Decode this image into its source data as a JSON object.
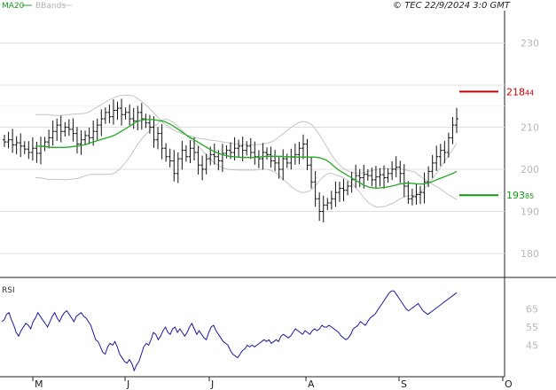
{
  "header": {
    "legend_ma": "MA20",
    "legend_bb": "BBands",
    "timestamp": "© TEC 22/9/2024 3:0 GMT"
  },
  "colors": {
    "price": "#111111",
    "ma": "#22aa22",
    "bands": "#c4c4c4",
    "rsi": "#1a1aa0",
    "resistance": "#cc0000",
    "support": "#119911",
    "grid": "#e0e0e0"
  },
  "chart_data": [
    {
      "type": "ohlc",
      "title": "",
      "legend": [
        "MA20",
        "BBands"
      ],
      "y_ticks": [
        "230",
        "210",
        "200",
        "190",
        "180"
      ],
      "ylim": [
        176,
        236
      ],
      "x_labels": [
        "M",
        "J",
        "J",
        "A",
        "S",
        "O"
      ],
      "levels": [
        {
          "name": "resistance",
          "value": 218.44,
          "label_int": "218",
          "label_dec": "44",
          "color": "#cc0000"
        },
        {
          "name": "support",
          "value": 193.85,
          "label_int": "193",
          "label_dec": "85",
          "color": "#119911"
        }
      ],
      "close": [
        206.5,
        207.0,
        205.8,
        206.3,
        205.5,
        204.8,
        204.0,
        205.0,
        203.8,
        205.5,
        206.5,
        207.5,
        209.0,
        210.5,
        209.0,
        210.0,
        209.5,
        208.5,
        206.0,
        207.0,
        208.0,
        207.5,
        209.0,
        210.5,
        212.0,
        213.5,
        212.5,
        214.0,
        214.5,
        213.0,
        213.5,
        212.0,
        211.5,
        213.5,
        212.0,
        211.0,
        210.0,
        207.0,
        208.5,
        205.0,
        203.0,
        202.0,
        199.0,
        202.5,
        204.5,
        203.0,
        205.0,
        204.0,
        201.0,
        200.0,
        202.5,
        203.5,
        203.0,
        202.0,
        203.8,
        204.5,
        204.0,
        205.0,
        205.5,
        204.5,
        205.5,
        204.0,
        203.0,
        202.5,
        204.0,
        203.5,
        202.0,
        201.5,
        200.0,
        202.5,
        201.5,
        203.0,
        203.5,
        205.0,
        206.0,
        201.0,
        197.0,
        193.0,
        190.0,
        191.5,
        192.0,
        193.0,
        194.5,
        195.5,
        195.0,
        196.0,
        197.5,
        198.5,
        198.0,
        198.8,
        198.5,
        197.5,
        198.2,
        198.7,
        198.0,
        199.0,
        200.0,
        200.5,
        199.0,
        196.0,
        193.0,
        193.5,
        194.0,
        194.5,
        197.0,
        199.5,
        201.5,
        203.0,
        204.5,
        204.0,
        207.5,
        210.5,
        212.0
      ],
      "ma20": [
        205.5,
        205.5,
        205.4,
        205.3,
        205.2,
        205.2,
        205.2,
        205.2,
        205.3,
        205.4,
        205.5,
        205.7,
        205.9,
        206.3,
        206.6,
        206.9,
        207.2,
        207.5,
        207.8,
        208.2,
        208.8,
        209.4,
        210.0,
        210.7,
        211.3,
        211.6,
        211.8,
        211.8,
        211.8,
        211.6,
        211.5,
        211.2,
        210.7,
        210.1,
        209.4,
        208.7,
        208.0,
        207.4,
        206.8,
        206.2,
        205.6,
        205.0,
        204.4,
        204.0,
        203.6,
        203.3,
        203.1,
        203.0,
        202.9,
        202.8,
        202.8,
        202.8,
        202.8,
        202.9,
        203.0,
        203.1,
        203.1,
        203.1,
        203.1,
        203.0,
        203.0,
        202.9,
        202.9,
        202.9,
        202.9,
        202.9,
        202.9,
        202.8,
        202.6,
        202.2,
        201.5,
        200.6,
        199.8,
        199.2,
        198.6,
        198.0,
        197.4,
        196.8,
        196.2,
        195.8,
        195.6,
        195.5,
        195.6,
        195.7,
        195.9,
        196.1,
        196.4,
        196.6,
        196.7,
        196.7,
        196.6,
        196.5,
        196.5,
        196.7,
        197.0,
        197.4,
        197.8,
        198.2,
        198.6,
        199.0,
        199.5
      ],
      "upper_band": [
        213.0,
        213.0,
        213.0,
        213.0,
        212.8,
        212.8,
        212.8,
        212.9,
        213.0,
        213.1,
        213.2,
        213.2,
        213.3,
        213.8,
        214.4,
        215.0,
        215.6,
        216.2,
        216.7,
        217.2,
        217.5,
        217.6,
        217.6,
        217.5,
        217.0,
        216.3,
        215.5,
        214.5,
        213.5,
        212.4,
        211.3,
        210.5,
        209.8,
        209.2,
        208.8,
        208.4,
        208.1,
        207.8,
        207.5,
        207.3,
        207.2,
        207.0,
        206.9,
        206.8,
        206.6,
        206.4,
        206.3,
        206.1,
        206.0,
        205.8,
        205.8,
        205.8,
        205.8,
        205.9,
        206.0,
        206.2,
        206.5,
        207.0,
        207.8,
        208.6,
        209.4,
        210.2,
        210.8,
        211.3,
        211.3,
        211.0,
        210.2,
        208.8,
        207.3,
        205.6,
        203.9,
        202.4,
        201.2,
        200.3,
        199.7,
        199.3,
        199.1,
        199.1,
        199.2,
        199.5,
        199.7,
        200.0,
        200.1,
        200.2,
        200.2,
        200.2,
        200.1,
        200.0,
        199.8,
        199.6,
        199.4,
        198.6,
        197.9,
        197.2,
        196.6,
        196.0,
        195.4,
        194.7,
        194.0,
        193.4,
        192.8
      ]
    },
    {
      "type": "line",
      "title": "",
      "name": "RSI",
      "y_ticks": [
        "65",
        "55",
        "45"
      ],
      "ylim": [
        30,
        80
      ],
      "values": [
        58,
        59,
        62,
        63,
        59,
        56,
        52,
        50,
        53,
        55,
        57,
        56,
        54,
        58,
        60,
        63,
        61,
        59,
        57,
        55,
        58,
        61,
        63,
        60,
        58,
        61,
        63,
        64,
        62,
        60,
        58,
        61,
        62,
        63,
        61,
        60,
        58,
        56,
        52,
        48,
        47,
        44,
        41,
        40,
        44,
        46,
        45,
        47,
        44,
        40,
        38,
        36,
        35,
        37,
        35,
        31,
        34,
        36,
        40,
        44,
        46,
        45,
        48,
        52,
        51,
        48,
        50,
        53,
        55,
        52,
        51,
        54,
        55,
        52,
        54,
        52,
        50,
        52,
        55,
        57,
        54,
        51,
        53,
        51,
        49,
        48,
        52,
        55,
        56,
        53,
        51,
        49,
        47,
        46,
        45,
        42,
        40,
        39,
        38,
        40,
        42,
        43,
        45,
        44,
        45,
        44,
        45,
        46,
        47,
        48,
        47,
        48,
        46,
        47,
        48,
        47,
        50,
        51,
        50,
        49,
        50,
        52,
        54,
        53,
        52,
        51,
        53,
        52,
        51,
        53,
        54,
        53,
        54,
        56,
        55,
        55,
        56,
        55,
        54,
        53,
        52,
        50,
        49,
        48,
        49,
        51,
        54,
        55,
        56,
        58,
        57,
        56,
        58,
        60,
        61,
        62,
        64,
        66,
        68,
        70,
        72,
        74,
        75,
        75,
        73,
        71,
        69,
        67,
        65,
        64,
        65,
        66,
        67,
        68,
        66,
        64,
        63,
        62,
        63,
        64,
        65,
        66,
        67,
        68,
        69,
        70,
        71,
        72,
        73,
        74
      ]
    }
  ]
}
